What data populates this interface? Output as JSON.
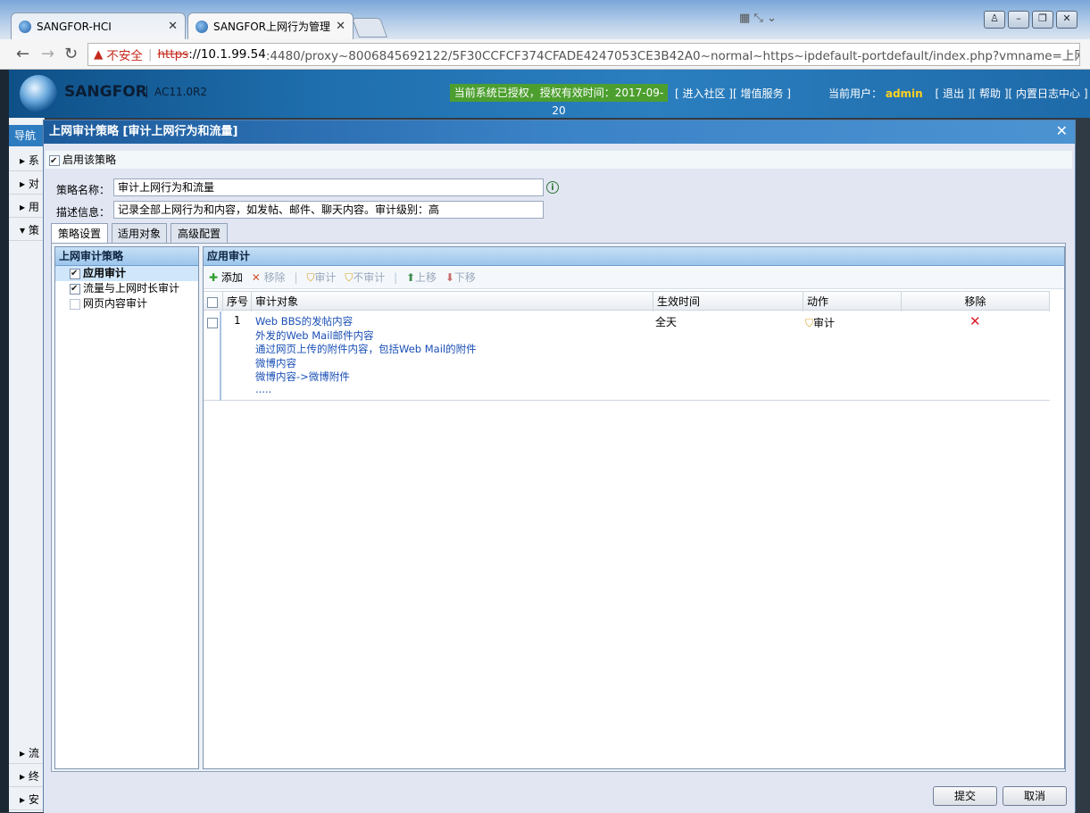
{
  "browser": {
    "tabs": [
      {
        "label": "SANGFOR-HCI"
      },
      {
        "label": "SANGFOR上网行为管理"
      }
    ],
    "address": {
      "security": "不安全",
      "scheme": "https",
      "host": "://10.1.99.54",
      "path": ":4480/proxy~8006845692122/5F30CCFCF374CFADE4247053CE3B42A0~normal~https~ipdefault-portdefault/index.php?vmname=上网行"
    }
  },
  "app": {
    "brand": "SANGFOR",
    "version": "AC11.0R2",
    "license": "当前系统已授权，授权有效时间：2017-09-20",
    "links": "[ 进入社区 ][ 增值服务 ]",
    "current_user_label": "当前用户：",
    "current_user": "admin",
    "user_links": "[ 退出 ][ 帮助 ][ 内置日志中心 ]"
  },
  "bgnav": {
    "header": "导航",
    "items": [
      "系",
      "对",
      "用",
      "策",
      "流",
      "终",
      "安"
    ]
  },
  "dialog": {
    "title": "上网审计策略 [审计上网行为和流量]",
    "enable_label": "启用该策略",
    "name_label": "策略名称：",
    "name_value": "审计上网行为和流量",
    "desc_label": "描述信息：",
    "desc_value": "记录全部上网行为和内容，如发帖、邮件、聊天内容。审计级别：高",
    "tabs": [
      {
        "label": "策略设置",
        "active": true
      },
      {
        "label": "适用对象",
        "active": false
      },
      {
        "label": "高级配置",
        "active": false
      }
    ],
    "left_panel": {
      "title": "上网审计策略",
      "items": [
        {
          "label": "应用审计",
          "checked": true,
          "selected": true
        },
        {
          "label": "流量与上网时长审计",
          "checked": true,
          "selected": false
        },
        {
          "label": "网页内容审计",
          "checked": false,
          "selected": false
        }
      ]
    },
    "right_panel": {
      "title": "应用审计",
      "toolbar": {
        "add": "添加",
        "remove": "移除",
        "audit": "审计",
        "no_audit": "不审计",
        "move_up": "上移",
        "move_down": "下移"
      },
      "columns": {
        "index": "序号",
        "object": "审计对象",
        "time": "生效时间",
        "action": "动作",
        "remove": "移除"
      },
      "rows": [
        {
          "index": "1",
          "objects": [
            "Web BBS的发帖内容",
            "外发的Web Mail邮件内容",
            "通过网页上传的附件内容，包括Web Mail的附件",
            "微博内容",
            "微博内容->微博附件",
            "....."
          ],
          "time": "全天",
          "action": "审计"
        }
      ]
    },
    "buttons": {
      "submit": "提交",
      "cancel": "取消"
    }
  }
}
